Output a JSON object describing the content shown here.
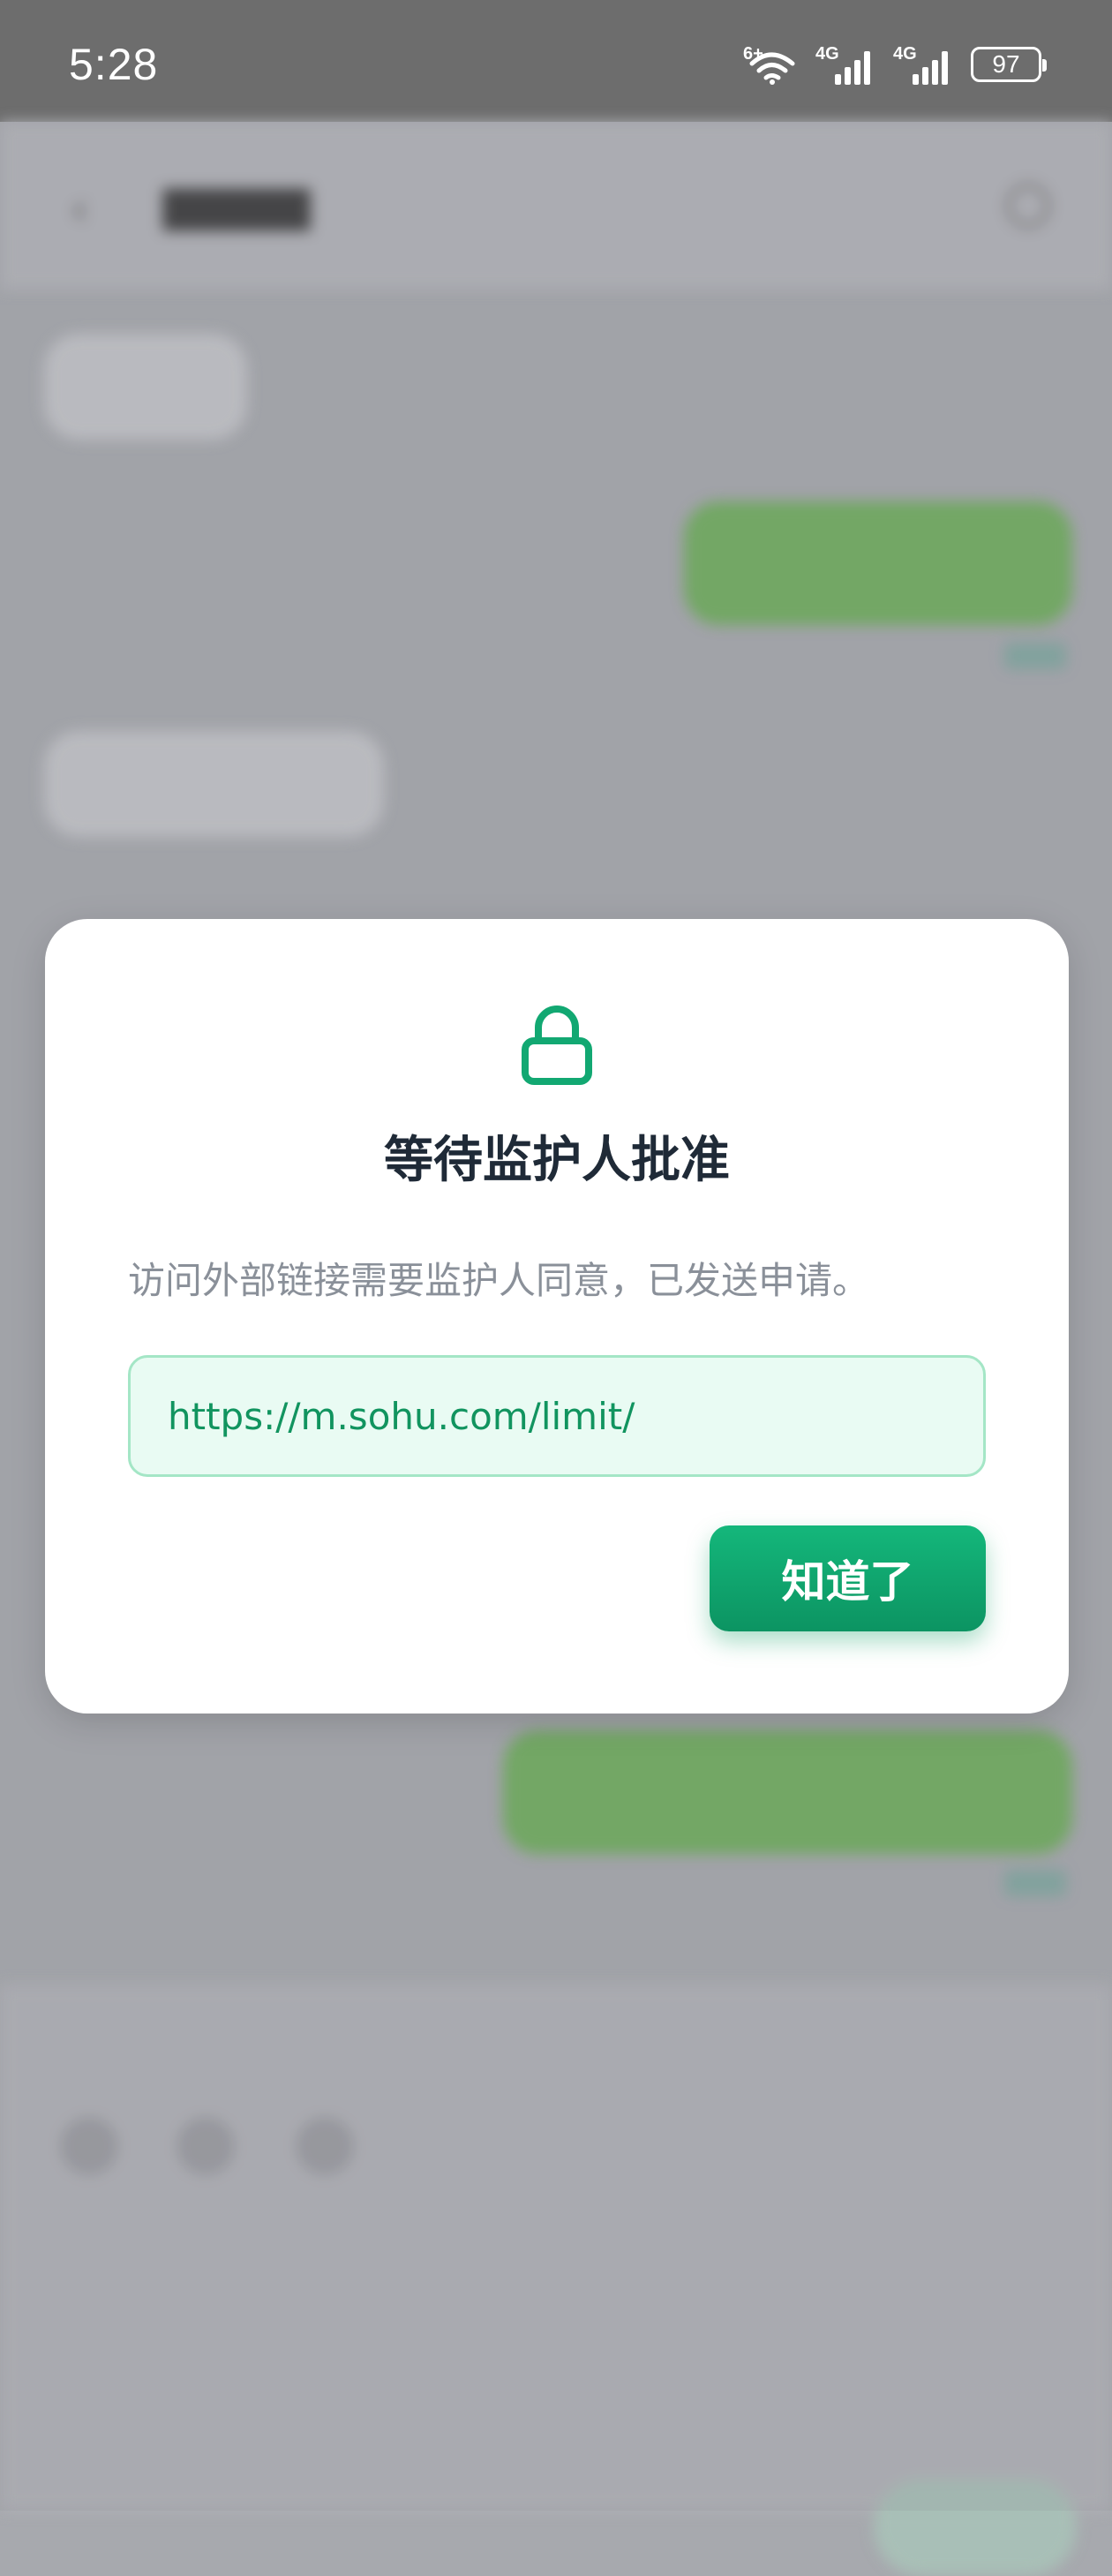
{
  "status_bar": {
    "time": "5:28",
    "wifi_badge": "6+",
    "signal_1_label": "4G",
    "signal_2_label": "4G",
    "battery": "97"
  },
  "dialog": {
    "icon": "lock-icon",
    "title": "等待监护人批准",
    "message": "访问外部链接需要监护人同意，已发送申请。",
    "url": "https://m.sohu.com/limit/",
    "button_label": "知道了"
  },
  "colors": {
    "accent": "#12a872",
    "url_background": "#e9fbf3",
    "url_border": "#a4e6c6",
    "title": "#1f2a37",
    "message": "#8a9099"
  }
}
